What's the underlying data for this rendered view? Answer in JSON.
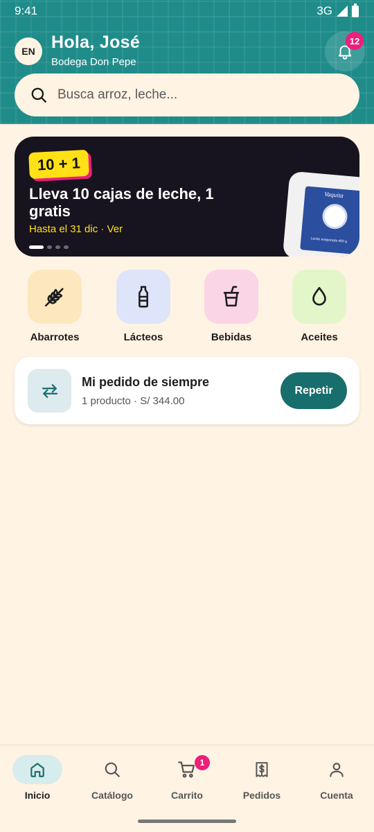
{
  "status_bar": {
    "time": "9:41",
    "network": "3G"
  },
  "header": {
    "language_badge": "EN",
    "greeting": "Hola, José",
    "store_name": "Bodega Don Pepe",
    "notifications_count": "12"
  },
  "search": {
    "placeholder": "Busca arroz, leche..."
  },
  "promo": {
    "tag": "10 + 1",
    "title": "Lleva 10 cajas de leche, 1 gratis",
    "subtitle": "Hasta el 31 dic · Ver",
    "product_brand": "Vaquita",
    "product_desc": "Leche evaporada 400 g",
    "slides_total": 4,
    "active_slide": 1
  },
  "categories": [
    {
      "label": "Abarrotes",
      "icon": "wheat-icon",
      "color": "#FCE7BE"
    },
    {
      "label": "Lácteos",
      "icon": "milk-bottle-icon",
      "color": "#DEE4FA"
    },
    {
      "label": "Bebidas",
      "icon": "drink-cup-icon",
      "color": "#FAD5E6"
    },
    {
      "label": "Aceites",
      "icon": "oil-drop-icon",
      "color": "#E3F6C9"
    }
  ],
  "reorder": {
    "title": "Mi pedido de siempre",
    "subtitle": "1 producto · S/ 344.00",
    "button_label": "Repetir",
    "icon": "repeat-arrows-icon"
  },
  "nav": {
    "items": [
      {
        "label": "Inicio",
        "icon": "home-icon",
        "active": true
      },
      {
        "label": "Catálogo",
        "icon": "search-icon",
        "active": false
      },
      {
        "label": "Carrito",
        "icon": "cart-icon",
        "active": false
      },
      {
        "label": "Pedidos",
        "icon": "receipt-icon",
        "active": false
      },
      {
        "label": "Cuenta",
        "icon": "user-icon",
        "active": false
      }
    ],
    "cart_count": "1"
  },
  "colors": {
    "header_teal": "#1F8C8A",
    "background_cream": "#FFF3E3",
    "accent_pink": "#EC1F7B",
    "promo_yellow": "#FFE115",
    "button_teal": "#176E6D"
  }
}
